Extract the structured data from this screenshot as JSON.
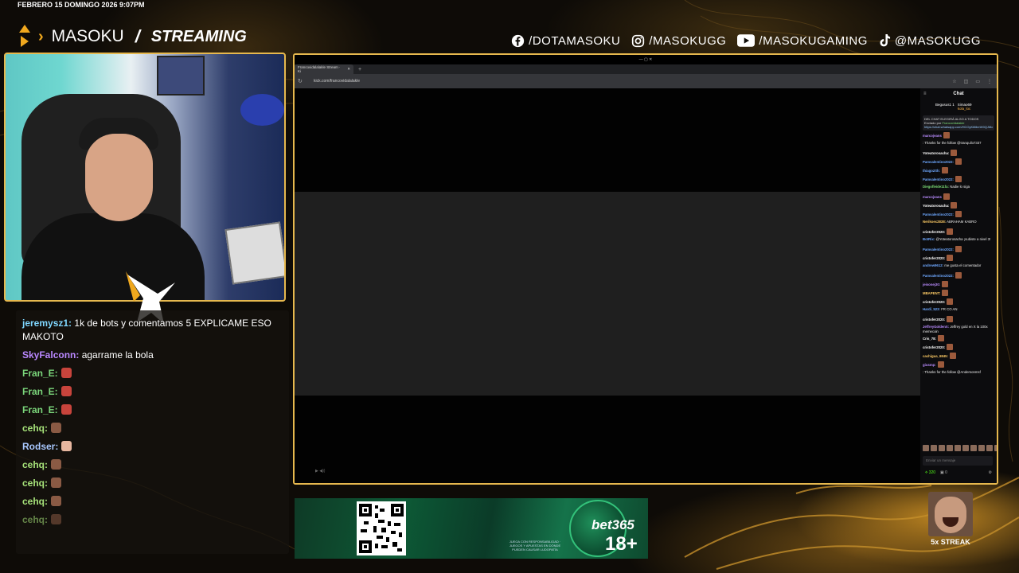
{
  "overlay": {
    "datetime": "FEBRERO 15 DOMINGO 2026 9:07PM",
    "brand_name": "MASOKU",
    "brand_slash": "/",
    "brand_stream": "STREAMING",
    "socials": [
      {
        "icon": "facebook-icon",
        "label": "/DOTAMASOKU"
      },
      {
        "icon": "instagram-icon",
        "label": "/MASOKUGG"
      },
      {
        "icon": "youtube-icon",
        "label": "/MASOKUGAMING"
      },
      {
        "icon": "tiktok-icon",
        "label": "@MASOKUGG"
      }
    ],
    "accent_color": "#e6b84e"
  },
  "stream_chat": [
    {
      "user": "jeremysz1:",
      "text": "1k de bots y comentamos 5 EXPLICAME ESO MAKOTO",
      "color": "#7fd7ff",
      "emote": ""
    },
    {
      "user": "SkyFalconn:",
      "text": "agarrame la bola",
      "color": "#b987ff",
      "emote": ""
    },
    {
      "user": "Fran_E:",
      "text": "",
      "color": "#7bd67b",
      "emote": "red"
    },
    {
      "user": "Fran_E:",
      "text": "",
      "color": "#7bd67b",
      "emote": "red"
    },
    {
      "user": "Fran_E:",
      "text": "",
      "color": "#7bd67b",
      "emote": "red"
    },
    {
      "user": "cehq:",
      "text": "",
      "color": "#a7e37a",
      "emote": "brown"
    },
    {
      "user": "Rodser:",
      "text": "",
      "color": "#a9c8ff",
      "emote": "hand"
    },
    {
      "user": "cehq:",
      "text": "",
      "color": "#a7e37a",
      "emote": "brown"
    },
    {
      "user": "cehq:",
      "text": "",
      "color": "#a7e37a",
      "emote": "brown"
    },
    {
      "user": "cehq:",
      "text": "",
      "color": "#a7e37a",
      "emote": "brown"
    },
    {
      "user": "cehq:",
      "text": "",
      "color": "#a7e37a",
      "emote": "brown"
    }
  ],
  "browser": {
    "tab_title": "Francovidalalakle Stream · Ki",
    "url": "kick.com/francovidalalakle",
    "new_tab": "+",
    "close": "✕"
  },
  "kick_chat": {
    "title": "Chat",
    "gifter1": "Begusus1",
    "gifter1_count": "1",
    "gifter2": "Simao69",
    "gifter3": "kola_loc",
    "pinned_top": "DEL CHAT ELEGIRÁ ALGO A TODOS",
    "pinned_by": "Enviado por",
    "pinned_user": "Francovidalakle",
    "pinned_link": "https://chat.whatsapp.com/HCOyK6tllerW0QJMc",
    "messages": [
      {
        "user": "marcojeans",
        "text": "",
        "color": "#ba8cff",
        "emote": true
      },
      {
        "user": "",
        "text": ": Thanks for the follow @tranquilo7337",
        "color": "#ff4d4d",
        "emote": false
      },
      {
        "user": "Yoteatorosacha:",
        "text": "",
        "color": "#ffffff",
        "emote": true
      },
      {
        "user": "Pamvalentino2022:",
        "text": "",
        "color": "#6ea8ff",
        "emote": true
      },
      {
        "user": "thiagoztth:",
        "text": "",
        "color": "#6ea8ff",
        "emote": true
      },
      {
        "user": "Pamvalentino2022:",
        "text": "",
        "color": "#6ea8ff",
        "emote": true
      },
      {
        "user": "Diegofleide11fa:",
        "text": "Nadie lo siga",
        "color": "#7ddf77",
        "emote": false
      },
      {
        "user": "marcojeans",
        "text": "",
        "color": "#ba8cff",
        "emote": true
      },
      {
        "user": "Yoteatorosacha:",
        "text": "",
        "color": "#ffffff",
        "emote": true
      },
      {
        "user": "Pamvalentino2022:",
        "text": "",
        "color": "#6ea8ff",
        "emote": true
      },
      {
        "user": "Nerikoec2838:",
        "text": "ABRAHAM KABRO",
        "color": "#ffcc66",
        "emote": false
      },
      {
        "user": "cristofer2020:",
        "text": "",
        "color": "#ffffff",
        "emote": true
      },
      {
        "user": "BotRix:",
        "text": "@Yoteatorosacha ¡subiste a nivel 3!",
        "color": "#6ea8ff",
        "emote": false
      },
      {
        "user": "Pamvalentino2022:",
        "text": "",
        "color": "#6ea8ff",
        "emote": true
      },
      {
        "user": "cristofer2020:",
        "text": "",
        "color": "#ffffff",
        "emote": true
      },
      {
        "user": "andrew9612:",
        "text": "me gusta el comentador",
        "color": "#6ea8ff",
        "emote": false
      },
      {
        "user": "Pamvalentino2022:",
        "text": "",
        "color": "#6ea8ff",
        "emote": true
      },
      {
        "user": "jeisonej30:",
        "text": "",
        "color": "#ba8cff",
        "emote": true
      },
      {
        "user": "MBAPENT:",
        "text": "",
        "color": "#ffcc66",
        "emote": true
      },
      {
        "user": "cristofer2020:",
        "text": "",
        "color": "#ffffff",
        "emote": true
      },
      {
        "user": "Hardi_523:",
        "text": "FR CO AN",
        "color": "#6ea8ff",
        "emote": false
      },
      {
        "user": "cristofer2020:",
        "text": "",
        "color": "#ffffff",
        "emote": true
      },
      {
        "user": "JeffreyGoldenX:",
        "text": "Jeffrey gold en X la 100x memecoin",
        "color": "#ba8cff",
        "emote": false
      },
      {
        "user": "Cris_78:",
        "text": "",
        "color": "#ffffff",
        "emote": true
      },
      {
        "user": "cristofer2020:",
        "text": "",
        "color": "#ffffff",
        "emote": true
      },
      {
        "user": "cachigua_6845:",
        "text": "",
        "color": "#ffcc66",
        "emote": true
      },
      {
        "user": "giusmp:",
        "text": "",
        "color": "#ba8cff",
        "emote": true
      },
      {
        "user": "",
        "text": ": Thanks for the follow @Andersonmsf",
        "color": "#ff4d4d",
        "emote": false
      }
    ],
    "input_placeholder": "Enviar un mensaje",
    "points": "320",
    "gifts": "0"
  },
  "ad": {
    "brand": "bet365",
    "age": "18+",
    "disclaimer": "JUEGA CON RESPONSABILIDAD · JUEGOS Y APUESTAS EN DÓNDE PUEDEN CAUSAR LUDOPATÍA"
  },
  "streak": {
    "label": "5x STREAK"
  }
}
